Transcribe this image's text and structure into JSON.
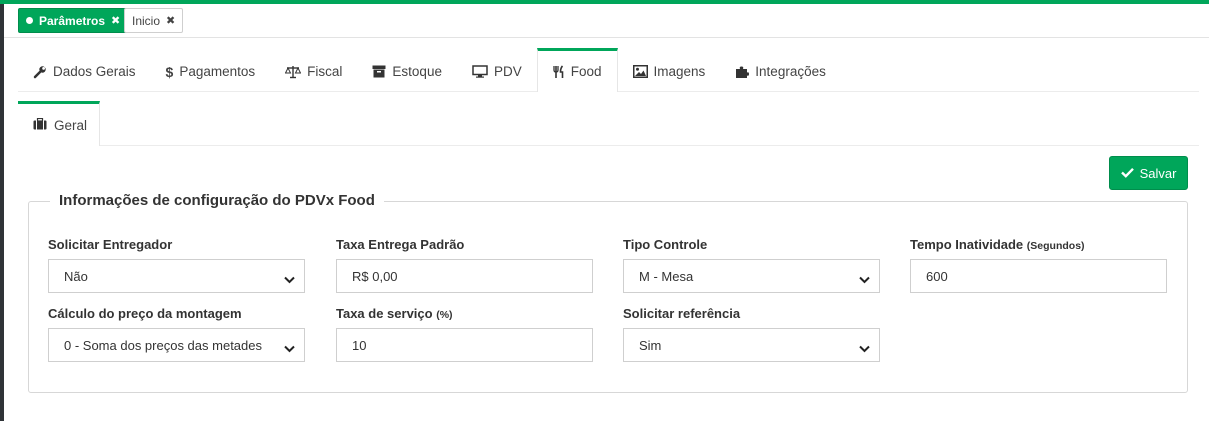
{
  "top_chips": {
    "active": {
      "label": "Parâmetros"
    },
    "inactive": {
      "label": "Inicio"
    }
  },
  "tabs": [
    {
      "label": "Dados Gerais",
      "icon": "wrench-icon"
    },
    {
      "label": "Pagamentos",
      "icon": "dollar-icon"
    },
    {
      "label": "Fiscal",
      "icon": "balance-scale-icon"
    },
    {
      "label": "Estoque",
      "icon": "archive-icon"
    },
    {
      "label": "PDV",
      "icon": "desktop-icon"
    },
    {
      "label": "Food",
      "icon": "utensils-icon",
      "active": true
    },
    {
      "label": "Imagens",
      "icon": "image-icon"
    },
    {
      "label": "Integrações",
      "icon": "puzzle-icon"
    }
  ],
  "subtab": {
    "label": "Geral",
    "icon": "briefcase-icon"
  },
  "save_button": {
    "label": "Salvar",
    "icon": "check-icon"
  },
  "section": {
    "title": "Informações de configuração do PDVx Food"
  },
  "fields": {
    "solicitar_entregador": {
      "label": "Solicitar Entregador",
      "value": "Não",
      "type": "select"
    },
    "taxa_entrega": {
      "label": "Taxa Entrega Padrão",
      "value": "R$ 0,00",
      "type": "input"
    },
    "tipo_controle": {
      "label": "Tipo Controle",
      "value": "M - Mesa",
      "type": "select"
    },
    "tempo_inatividade": {
      "label": "Tempo Inatividade",
      "label_hint": "(Segundos)",
      "value": "600",
      "type": "input"
    },
    "calculo_preco": {
      "label": "Cálculo do preço da montagem",
      "value": "0 - Soma dos preços das metades",
      "type": "select"
    },
    "taxa_servico": {
      "label": "Taxa de serviço",
      "label_hint": "(%)",
      "value": "10",
      "type": "input"
    },
    "solicitar_referencia": {
      "label": "Solicitar referência",
      "value": "Sim",
      "type": "select"
    }
  },
  "colors": {
    "accent": "#00a65a",
    "accent_dark": "#008d4c",
    "sidebar": "#2f3337"
  }
}
